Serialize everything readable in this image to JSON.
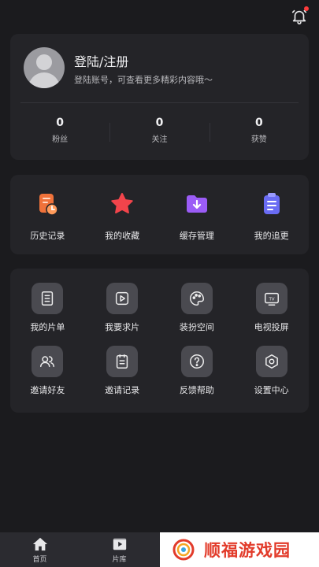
{
  "header": {
    "notification_icon": "bell-icon"
  },
  "profile": {
    "title": "登陆/注册",
    "subtitle": "登陆账号，可查看更多精彩内容哦～",
    "stats": [
      {
        "value": "0",
        "label": "粉丝"
      },
      {
        "value": "0",
        "label": "关注"
      },
      {
        "value": "0",
        "label": "获赞"
      }
    ]
  },
  "quick_actions": [
    {
      "label": "历史记录",
      "icon": "history-icon"
    },
    {
      "label": "我的收藏",
      "icon": "star-icon"
    },
    {
      "label": "缓存管理",
      "icon": "download-folder-icon"
    },
    {
      "label": "我的追更",
      "icon": "clipboard-icon"
    }
  ],
  "services": [
    {
      "label": "我的片单",
      "icon": "list-icon"
    },
    {
      "label": "我要求片",
      "icon": "play-request-icon"
    },
    {
      "label": "装扮空间",
      "icon": "palette-icon"
    },
    {
      "label": "电视投屏",
      "icon": "tv-icon"
    },
    {
      "label": "邀请好友",
      "icon": "users-icon"
    },
    {
      "label": "邀请记录",
      "icon": "document-icon"
    },
    {
      "label": "反馈帮助",
      "icon": "help-icon"
    },
    {
      "label": "设置中心",
      "icon": "settings-icon"
    }
  ],
  "tabbar": [
    {
      "label": "首页",
      "icon": "home-icon"
    },
    {
      "label": "片库",
      "icon": "film-icon"
    }
  ],
  "watermark": {
    "text": "顺福游戏园"
  },
  "colors": {
    "background": "#1b1b1e",
    "card": "#242428",
    "accent_red": "#e23b2a"
  }
}
